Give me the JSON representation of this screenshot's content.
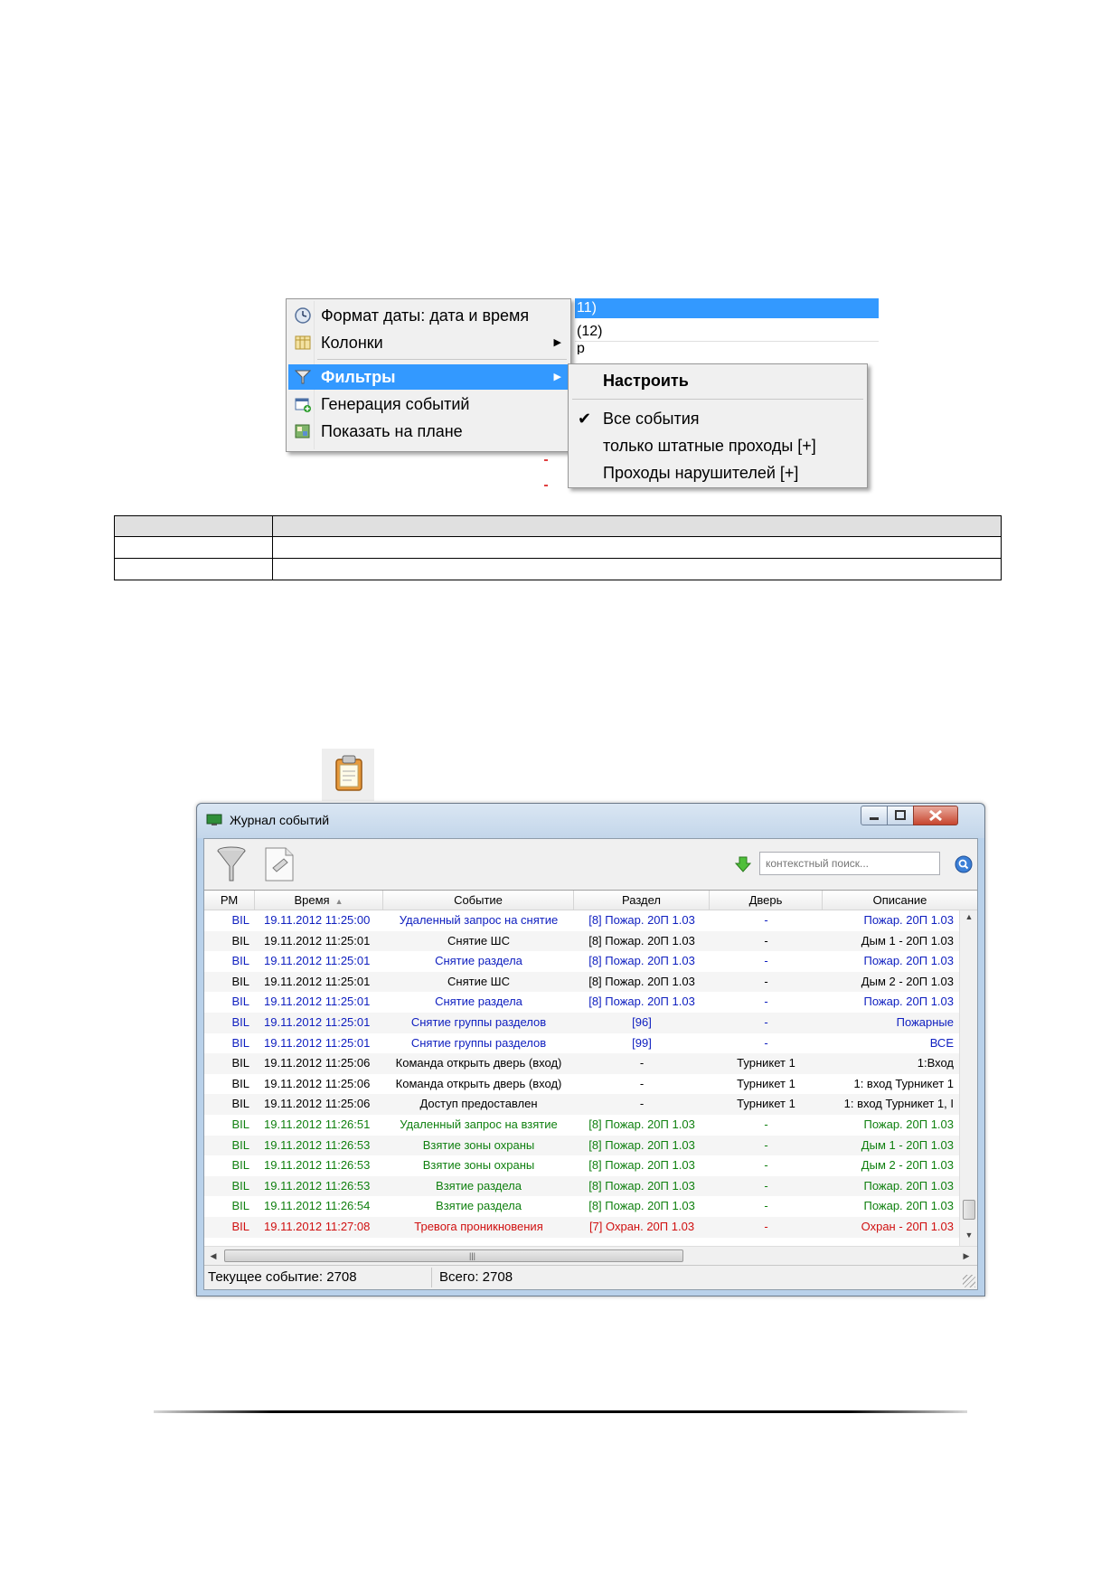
{
  "context_menu": {
    "background_rows": [
      "11)",
      "(12)",
      "р"
    ],
    "items": [
      {
        "label": "Формат даты: дата и время",
        "icon": "clock-icon"
      },
      {
        "label": "Колонки",
        "icon": "columns-icon",
        "has_submenu": true
      },
      {
        "label": "Фильтры",
        "icon": "filter-icon",
        "has_submenu": true,
        "highlighted": true
      },
      {
        "label": "Генерация событий",
        "icon": "generate-events-icon"
      },
      {
        "label": "Показать на плане",
        "icon": "show-on-plan-icon"
      }
    ],
    "submenu": {
      "items": [
        {
          "label": "Настроить",
          "bold": true
        },
        {
          "label": "Все события",
          "checked": true
        },
        {
          "label": "только штатные проходы [+]"
        },
        {
          "label": "Проходы нарушителей [+]"
        }
      ]
    }
  },
  "event_log": {
    "title": "Журнал событий",
    "search_placeholder": "контекстный поиск...",
    "columns": [
      "РМ",
      "Время",
      "Событие",
      "Раздел",
      "Дверь",
      "Описание"
    ],
    "colors": {
      "blue": "#1020c0",
      "black": "#000000",
      "green": "#108010",
      "red": "#d01010"
    },
    "rows": [
      {
        "pm": "BIL",
        "time": "19.11.2012 11:25:00",
        "event": "Удаленный запрос на снятие",
        "section": "[8] Пожар. 20П 1.03",
        "door": "-",
        "desc": "Пожар. 20П 1.03",
        "color": "blue"
      },
      {
        "pm": "BIL",
        "time": "19.11.2012 11:25:01",
        "event": "Снятие ШС",
        "section": "[8] Пожар. 20П 1.03",
        "door": "-",
        "desc": "Дым 1 - 20П 1.03",
        "color": "black"
      },
      {
        "pm": "BIL",
        "time": "19.11.2012 11:25:01",
        "event": "Снятие раздела",
        "section": "[8] Пожар. 20П 1.03",
        "door": "-",
        "desc": "Пожар. 20П 1.03",
        "color": "blue"
      },
      {
        "pm": "BIL",
        "time": "19.11.2012 11:25:01",
        "event": "Снятие ШС",
        "section": "[8] Пожар. 20П 1.03",
        "door": "-",
        "desc": "Дым 2 - 20П 1.03",
        "color": "black"
      },
      {
        "pm": "BIL",
        "time": "19.11.2012 11:25:01",
        "event": "Снятие раздела",
        "section": "[8] Пожар. 20П 1.03",
        "door": "-",
        "desc": "Пожар. 20П 1.03",
        "color": "blue"
      },
      {
        "pm": "BIL",
        "time": "19.11.2012 11:25:01",
        "event": "Снятие группы разделов",
        "section": "[96]",
        "door": "-",
        "desc": "Пожарные",
        "color": "blue"
      },
      {
        "pm": "BIL",
        "time": "19.11.2012 11:25:01",
        "event": "Снятие группы разделов",
        "section": "[99]",
        "door": "-",
        "desc": "ВСЕ",
        "color": "blue"
      },
      {
        "pm": "BIL",
        "time": "19.11.2012 11:25:06",
        "event": "Команда открыть дверь (вход)",
        "section": "-",
        "door": "Турникет 1",
        "desc": "1:Вход",
        "color": "black"
      },
      {
        "pm": "BIL",
        "time": "19.11.2012 11:25:06",
        "event": "Команда открыть дверь (вход)",
        "section": "-",
        "door": "Турникет 1",
        "desc": "1: вход   Турникет 1",
        "color": "black"
      },
      {
        "pm": "BIL",
        "time": "19.11.2012 11:25:06",
        "event": "Доступ предоставлен",
        "section": "-",
        "door": "Турникет 1",
        "desc": "1: вход   Турникет 1, I",
        "color": "black"
      },
      {
        "pm": "BIL",
        "time": "19.11.2012 11:26:51",
        "event": "Удаленный запрос на взятие",
        "section": "[8] Пожар. 20П 1.03",
        "door": "-",
        "desc": "Пожар. 20П 1.03",
        "color": "green"
      },
      {
        "pm": "BIL",
        "time": "19.11.2012 11:26:53",
        "event": "Взятие зоны охраны",
        "section": "[8] Пожар. 20П 1.03",
        "door": "-",
        "desc": "Дым 1 - 20П 1.03",
        "color": "green"
      },
      {
        "pm": "BIL",
        "time": "19.11.2012 11:26:53",
        "event": "Взятие зоны охраны",
        "section": "[8] Пожар. 20П 1.03",
        "door": "-",
        "desc": "Дым 2 - 20П 1.03",
        "color": "green"
      },
      {
        "pm": "BIL",
        "time": "19.11.2012 11:26:53",
        "event": "Взятие раздела",
        "section": "[8] Пожар. 20П 1.03",
        "door": "-",
        "desc": "Пожар. 20П 1.03",
        "color": "green"
      },
      {
        "pm": "BIL",
        "time": "19.11.2012 11:26:54",
        "event": "Взятие раздела",
        "section": "[8] Пожар. 20П 1.03",
        "door": "-",
        "desc": "Пожар. 20П 1.03",
        "color": "green"
      },
      {
        "pm": "BIL",
        "time": "19.11.2012 11:27:08",
        "event": "Тревога проникновения",
        "section": "[7] Охран. 20П 1.03",
        "door": "-",
        "desc": "Охран - 20П 1.03",
        "color": "red"
      }
    ],
    "status": {
      "current": "Текущее событие: 2708",
      "total": "Всего: 2708"
    }
  }
}
